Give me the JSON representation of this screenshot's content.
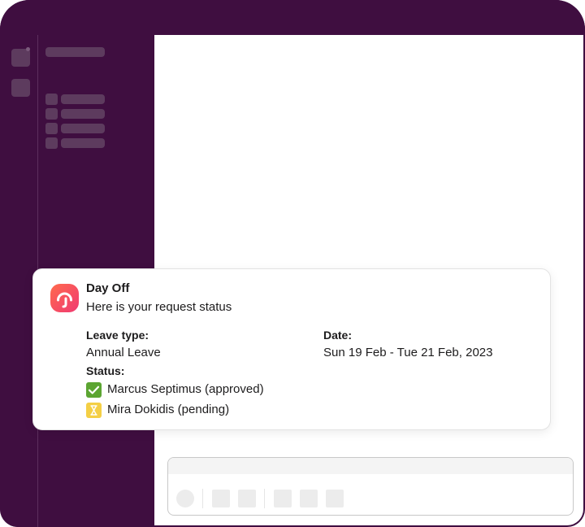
{
  "message": {
    "app_name": "Day Off",
    "subtitle": "Here is your request status",
    "leave_type_label": "Leave type:",
    "leave_type_value": "Annual Leave",
    "date_label": "Date:",
    "date_value": "Sun 19 Feb - Tue 21 Feb, 2023",
    "status_label": "Status:",
    "approvals": [
      {
        "name": "Marcus Septimus (approved)",
        "status": "approved",
        "icon": "checkmark-icon",
        "color": "#5ca532"
      },
      {
        "name": "Mira Dokidis (pending)",
        "status": "pending",
        "icon": "hourglass-icon",
        "color": "#f4cf45"
      }
    ]
  },
  "theme": {
    "sidebar_color": "#3f0e40",
    "logo_gradient": [
      "#ff6a4d",
      "#f03a72"
    ]
  }
}
